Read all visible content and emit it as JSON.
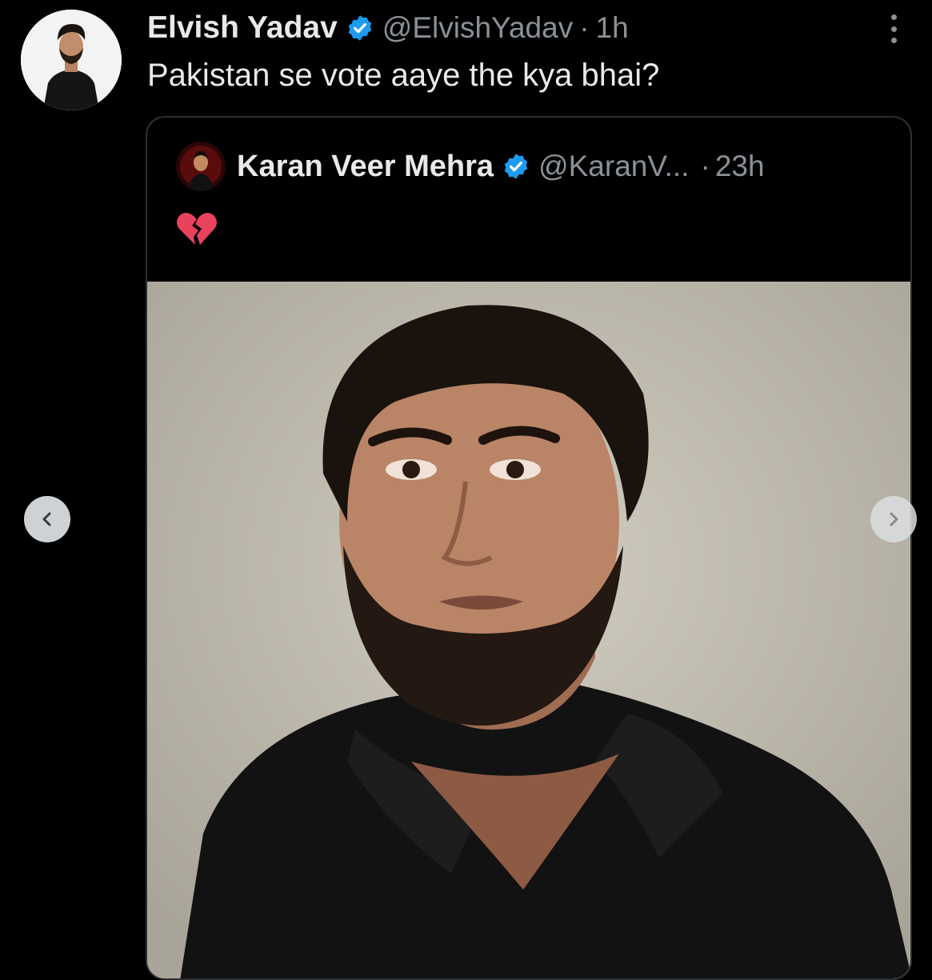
{
  "tweet": {
    "author_name": "Elvish Yadav",
    "handle": "@ElvishYadav",
    "separator": "·",
    "time": "1h",
    "text": "Pakistan se vote aaye the kya bhai?",
    "verified_icon": "verified-badge-icon",
    "more_icon": "more-options-icon"
  },
  "quote": {
    "author_name": "Karan Veer Mehra",
    "handle": "@KaranV...",
    "separator": "·",
    "time": "23h",
    "emoji": "broken-heart-emoji",
    "media": {
      "description_icon": "photo-portrait"
    }
  },
  "carousel": {
    "prev_icon": "chevron-left-icon",
    "next_icon": "chevron-right-icon"
  },
  "colors": {
    "background": "#000000",
    "text_primary": "#e7e9ea",
    "text_secondary": "#8b9196",
    "verified_blue": "#1d9bf0",
    "card_border": "#2b2f33"
  }
}
